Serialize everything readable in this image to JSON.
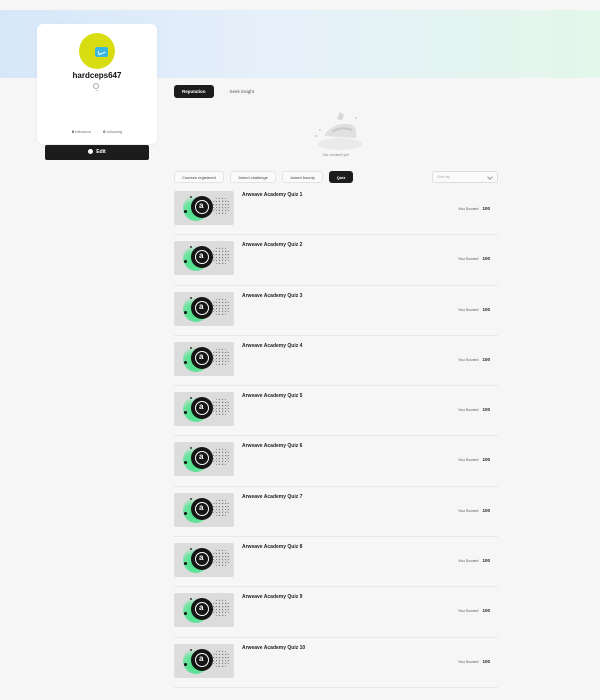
{
  "profile": {
    "username": "hardceps647",
    "bio_placeholder": "--",
    "followers": "0",
    "followers_label": "followers",
    "following": "0",
    "following_label": "following",
    "edit_label": "Edit"
  },
  "top_tabs": [
    {
      "label": "Reputation",
      "active": true
    },
    {
      "label": "Seek insight",
      "active": false
    }
  ],
  "empty_state": {
    "text": "No content yet"
  },
  "sub_tabs": [
    {
      "label": "Courses registered",
      "active": false
    },
    {
      "label": "Joined challenge",
      "active": false
    },
    {
      "label": "Joined bounty",
      "active": false
    },
    {
      "label": "Quiz",
      "active": true
    }
  ],
  "sort": {
    "placeholder": "Sort by"
  },
  "quizzes": [
    {
      "title": "Arweave Academy Quiz 1",
      "score_label": "You Scored",
      "score": "100"
    },
    {
      "title": "Arweave Academy Quiz 2",
      "score_label": "You Scored",
      "score": "100"
    },
    {
      "title": "Arweave Academy Quiz 3",
      "score_label": "You Scored",
      "score": "100"
    },
    {
      "title": "Arweave Academy Quiz 4",
      "score_label": "You Scored",
      "score": "100"
    },
    {
      "title": "Arweave Academy Quiz 5",
      "score_label": "You Scored",
      "score": "100"
    },
    {
      "title": "Arweave Academy Quiz 6",
      "score_label": "You Scored",
      "score": "100"
    },
    {
      "title": "Arweave Academy Quiz 7",
      "score_label": "You Scored",
      "score": "100"
    },
    {
      "title": "Arweave Academy Quiz 8",
      "score_label": "You Scored",
      "score": "100"
    },
    {
      "title": "Arweave Academy Quiz 9",
      "score_label": "You Scored",
      "score": "100"
    },
    {
      "title": "Arweave Academy Quiz 10",
      "score_label": "You Scored",
      "score": "100"
    }
  ],
  "colors": {
    "accent_dark": "#1c1c1c",
    "avatar": "#d7dd10",
    "badge": "#38b8e0",
    "glow": "#4be08a"
  }
}
